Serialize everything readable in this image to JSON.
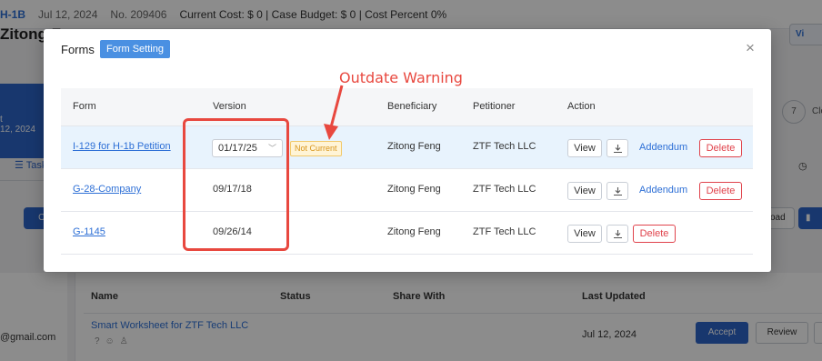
{
  "background": {
    "case_id": "H-1B",
    "date": "Jul 12, 2024",
    "case_no": "No. 209406",
    "cost_line": "Current Cost: $ 0 | Case Budget: $ 0 | Cost Percent 0%",
    "page_title": "Zitong F",
    "view_label": "Vi",
    "blue_card_line1": "t",
    "blue_card_line2": "12, 2024",
    "step_number": "7",
    "step_label": "Clo",
    "tab_label": "Task",
    "left_button_label": "O",
    "right_button1_label": "oad",
    "email": "@gmail.com",
    "table_headers": [
      "Name",
      "Status",
      "Share With",
      "Last Updated"
    ],
    "doc_name": "Smart Worksheet for ZTF Tech LLC",
    "doc_date": "Jul 12, 2024",
    "accept_label": "Accept",
    "review_label": "Review"
  },
  "modal": {
    "title": "Forms",
    "form_setting_label": "Form Setting",
    "close_glyph": "×",
    "columns": [
      "Form",
      "Version",
      "Beneficiary",
      "Petitioner",
      "Action"
    ],
    "rows": [
      {
        "form": "I-129 for H-1b Petition",
        "version": "01/17/25",
        "version_is_select": true,
        "status_badge": "Not Current",
        "beneficiary": "Zitong Feng",
        "petitioner": "ZTF Tech LLC",
        "view_label": "View",
        "addendum_label": "Addendum",
        "delete_label": "Delete"
      },
      {
        "form": "G-28-Company",
        "version": "09/17/18",
        "beneficiary": "Zitong Feng",
        "petitioner": "ZTF Tech LLC",
        "view_label": "View",
        "addendum_label": "Addendum",
        "delete_label": "Delete"
      },
      {
        "form": "G-1145",
        "version": "09/26/14",
        "beneficiary": "Zitong Feng",
        "petitioner": "ZTF Tech LLC",
        "view_label": "View",
        "delete_label": "Delete"
      }
    ]
  },
  "annotation": {
    "label": "Outdate Warning",
    "color": "#e8483f"
  },
  "colors": {
    "accent": "#2d6fd6",
    "button_blue": "#4a90e2",
    "danger": "#e0434c",
    "warning_bg": "#fff4d6",
    "warning_text": "#d8951c",
    "row_highlight": "#e8f3fd"
  }
}
